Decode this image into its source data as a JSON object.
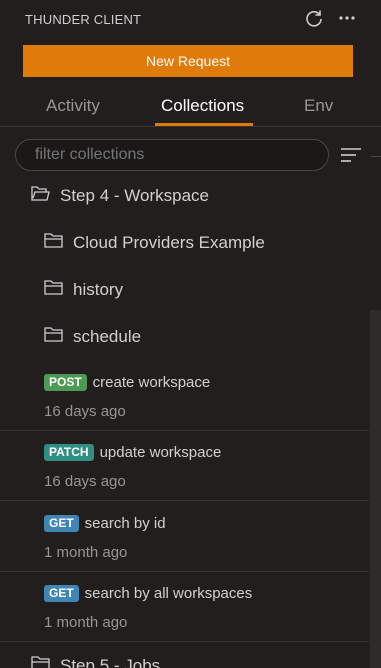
{
  "header": {
    "title": "THUNDER CLIENT",
    "refresh_icon": "refresh-icon",
    "more_icon": "more-icon"
  },
  "new_request_label": "New Request",
  "tabs": [
    {
      "label": "Activity",
      "active": false
    },
    {
      "label": "Collections",
      "active": true
    },
    {
      "label": "Env",
      "active": false
    }
  ],
  "filter": {
    "placeholder": "filter collections"
  },
  "tree": {
    "root_folder": "Step 4 - Workspace",
    "subfolders": [
      "Cloud Providers Example",
      "history",
      "schedule"
    ],
    "requests": [
      {
        "method": "POST",
        "name": "create workspace",
        "time": "16 days ago",
        "color": "#4e9a55"
      },
      {
        "method": "PATCH",
        "name": "update workspace",
        "time": "16 days ago",
        "color": "#2f8f83"
      },
      {
        "method": "GET",
        "name": "search by id",
        "time": "1 month ago",
        "color": "#3f86b5"
      },
      {
        "method": "GET",
        "name": "search by all workspaces",
        "time": "1 month ago",
        "color": "#3f86b5"
      }
    ],
    "next_folder": "Step 5 - Jobs"
  },
  "colors": {
    "accent": "#e07a0a",
    "background": "#211e1d"
  }
}
